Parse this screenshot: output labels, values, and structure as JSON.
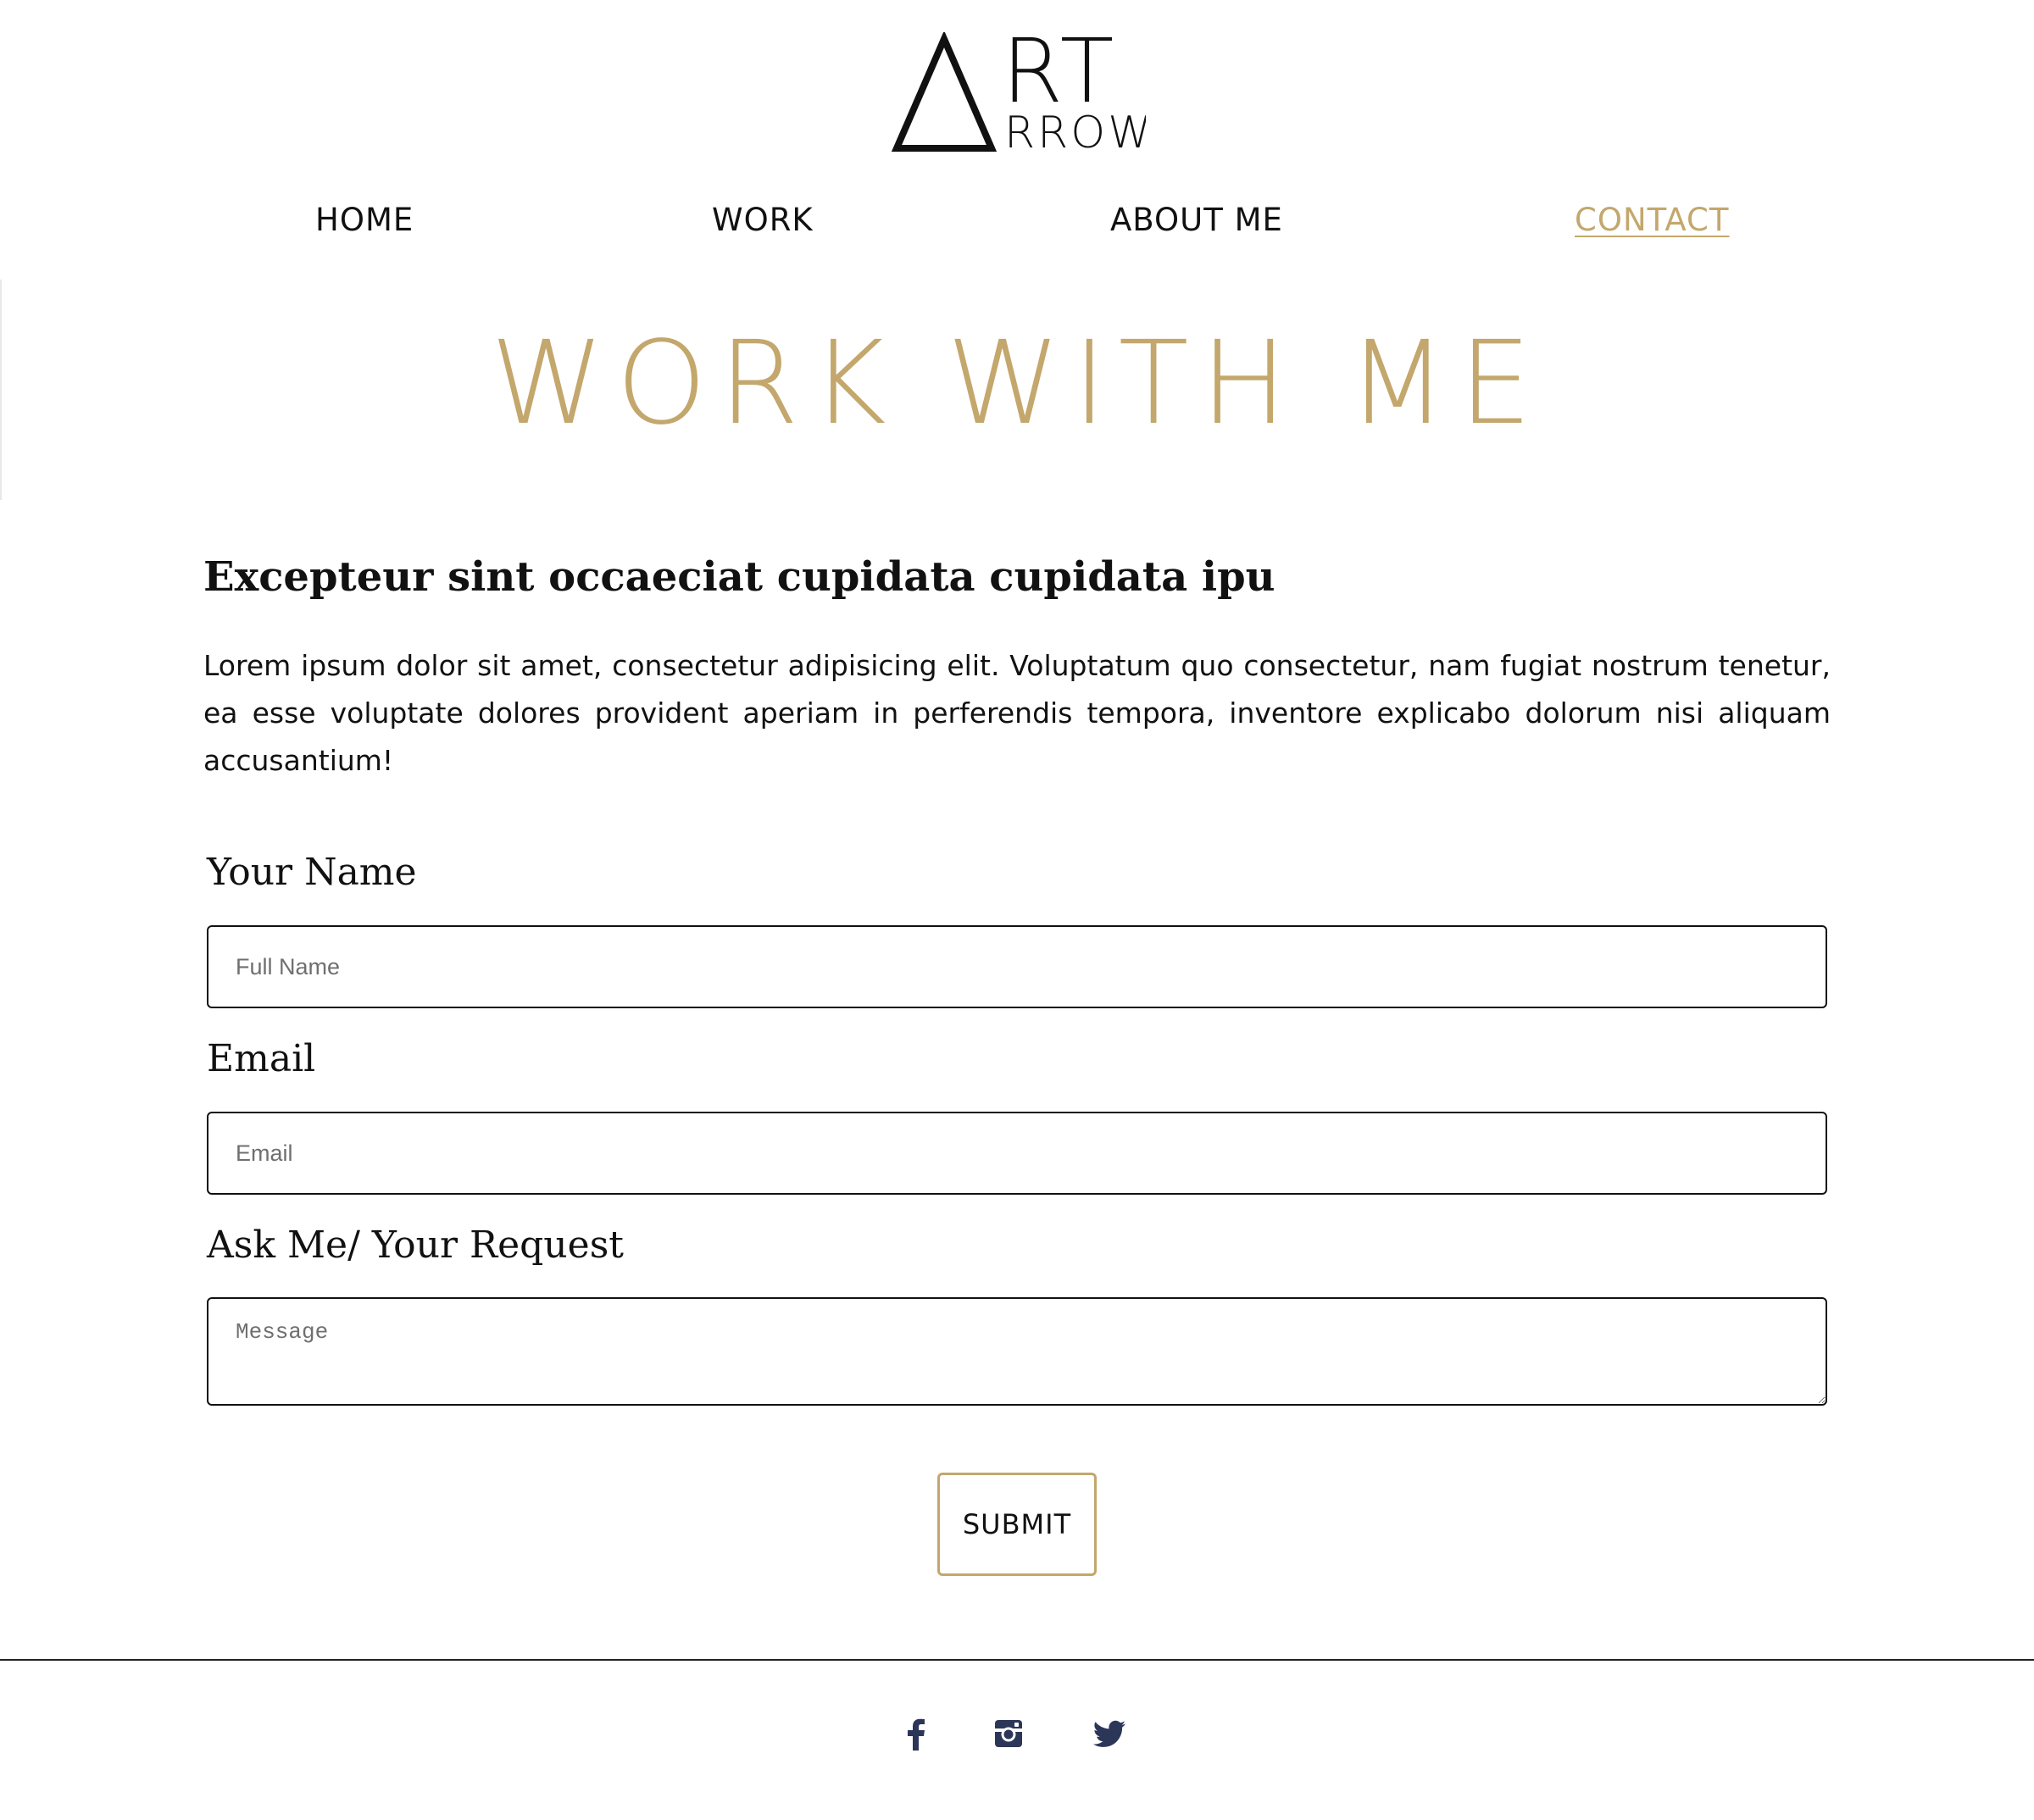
{
  "brand": {
    "logo_rt": "RT",
    "logo_rrow": "RROW",
    "logo_alt": "ART ARROW",
    "accent_color": "#c3a76c",
    "text_color": "#111111",
    "icon_color": "#2c3658"
  },
  "nav": {
    "items": [
      {
        "label": "HOME",
        "active": false
      },
      {
        "label": "WORK",
        "active": false
      },
      {
        "label": "ABOUT ME",
        "active": false
      },
      {
        "label": "CONTACT",
        "active": true
      }
    ]
  },
  "hero": {
    "title": "WORK WITH ME"
  },
  "intro": {
    "heading": "Excepteur sint occaeciat cupidata cupidata ipu",
    "text": "Lorem ipsum dolor sit amet, consectetur adipisicing elit. Voluptatum quo consectetur, nam fugiat nostrum tenetur, ea esse voluptate dolores provident aperiam in perferendis tempora, inventore explicabo dolorum nisi aliquam accusantium!"
  },
  "form": {
    "name_label": "Your Name",
    "name_placeholder": "Full Name",
    "name_value": "",
    "email_label": "Email",
    "email_placeholder": "Email",
    "email_value": "",
    "request_label": "Ask Me/ Your Request",
    "message_placeholder": "Message",
    "message_value": "",
    "submit_label": "SUBMIT"
  },
  "footer": {
    "social": [
      {
        "name": "facebook",
        "icon": "facebook-icon"
      },
      {
        "name": "instagram",
        "icon": "instagram-icon"
      },
      {
        "name": "twitter",
        "icon": "twitter-icon"
      }
    ]
  }
}
